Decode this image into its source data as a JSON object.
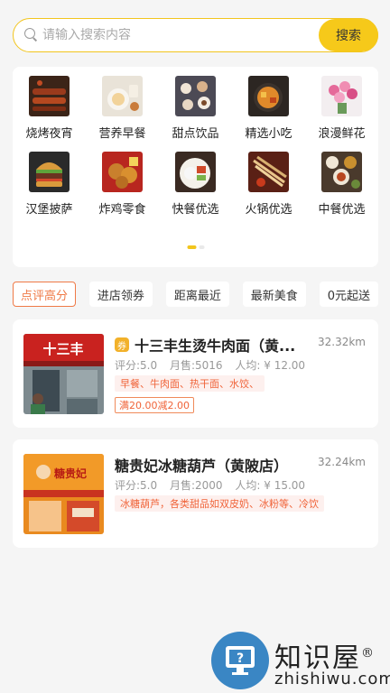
{
  "search": {
    "placeholder": "请输入搜索内容",
    "button_label": "搜索"
  },
  "categories": [
    {
      "label": "烧烤夜宵"
    },
    {
      "label": "营养早餐"
    },
    {
      "label": "甜点饮品"
    },
    {
      "label": "精选小吃"
    },
    {
      "label": "浪漫鲜花"
    },
    {
      "label": "汉堡披萨"
    },
    {
      "label": "炸鸡零食"
    },
    {
      "label": "快餐优选"
    },
    {
      "label": "火锅优选"
    },
    {
      "label": "中餐优选"
    }
  ],
  "filters": [
    "点评高分",
    "进店领券",
    "距离最近",
    "最新美食",
    "0元起送"
  ],
  "shops": [
    {
      "name": "十三丰生烫牛肉面（黄...",
      "voucher": "券",
      "distance": "32.32km",
      "rating": "评分:5.0",
      "sales": "月售:5016",
      "avg": "人均: ¥ 12.00",
      "tags": "早餐、牛肉面、热干面、水饺、",
      "promo": "满20.00减2.00",
      "sign_text": "十三丰"
    },
    {
      "name": "糖贵妃冰糖葫芦（黄陂店）",
      "distance": "32.24km",
      "rating": "评分:5.0",
      "sales": "月售:2000",
      "avg": "人均: ¥ 15.00",
      "tags": "冰糖葫芦，各类甜品如双皮奶、冰粉等、冷饮",
      "sign_text": "糖贵妃"
    }
  ],
  "watermark": {
    "cn": "知识屋",
    "en": "zhishiwu.com",
    "reg": "®"
  },
  "colors": {
    "accent": "#f6c91a",
    "promo": "#f0643a",
    "filter_active": "#ef7a47"
  }
}
